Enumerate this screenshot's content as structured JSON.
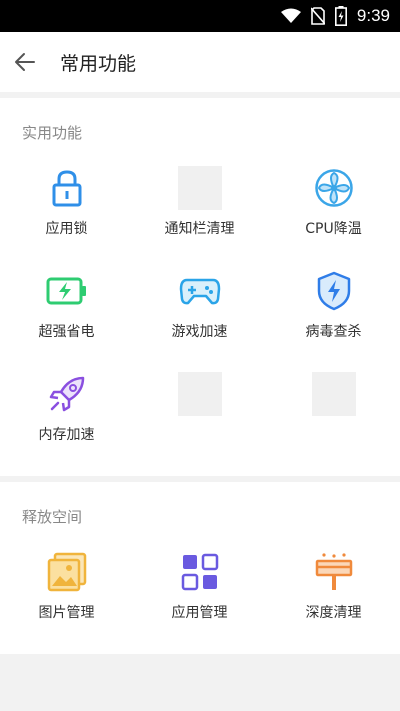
{
  "status_bar": {
    "time": "9:39"
  },
  "header": {
    "title": "常用功能"
  },
  "sections": [
    {
      "title": "实用功能",
      "items": [
        {
          "label": "应用锁",
          "icon": "lock-icon",
          "color": "#2f8fe8"
        },
        {
          "label": "通知栏清理",
          "icon": "placeholder",
          "color": "#eeeeee"
        },
        {
          "label": "CPU降温",
          "icon": "fan-icon",
          "color": "#3ba6e8"
        },
        {
          "label": "超强省电",
          "icon": "battery-icon",
          "color": "#2ecc71"
        },
        {
          "label": "游戏加速",
          "icon": "gamepad-icon",
          "color": "#2aa4e8"
        },
        {
          "label": "病毒查杀",
          "icon": "shield-icon",
          "color": "#2f7de8"
        },
        {
          "label": "内存加速",
          "icon": "rocket-icon",
          "color": "#8a4fe0"
        },
        {
          "label": "",
          "icon": "placeholder",
          "color": "#eeeeee"
        },
        {
          "label": "",
          "icon": "placeholder",
          "color": "#eeeeee"
        }
      ]
    },
    {
      "title": "释放空间",
      "items": [
        {
          "label": "图片管理",
          "icon": "image-icon",
          "color": "#f0b43c"
        },
        {
          "label": "应用管理",
          "icon": "apps-icon",
          "color": "#6a5ae0"
        },
        {
          "label": "深度清理",
          "icon": "broom-icon",
          "color": "#f08a3c"
        }
      ]
    }
  ]
}
